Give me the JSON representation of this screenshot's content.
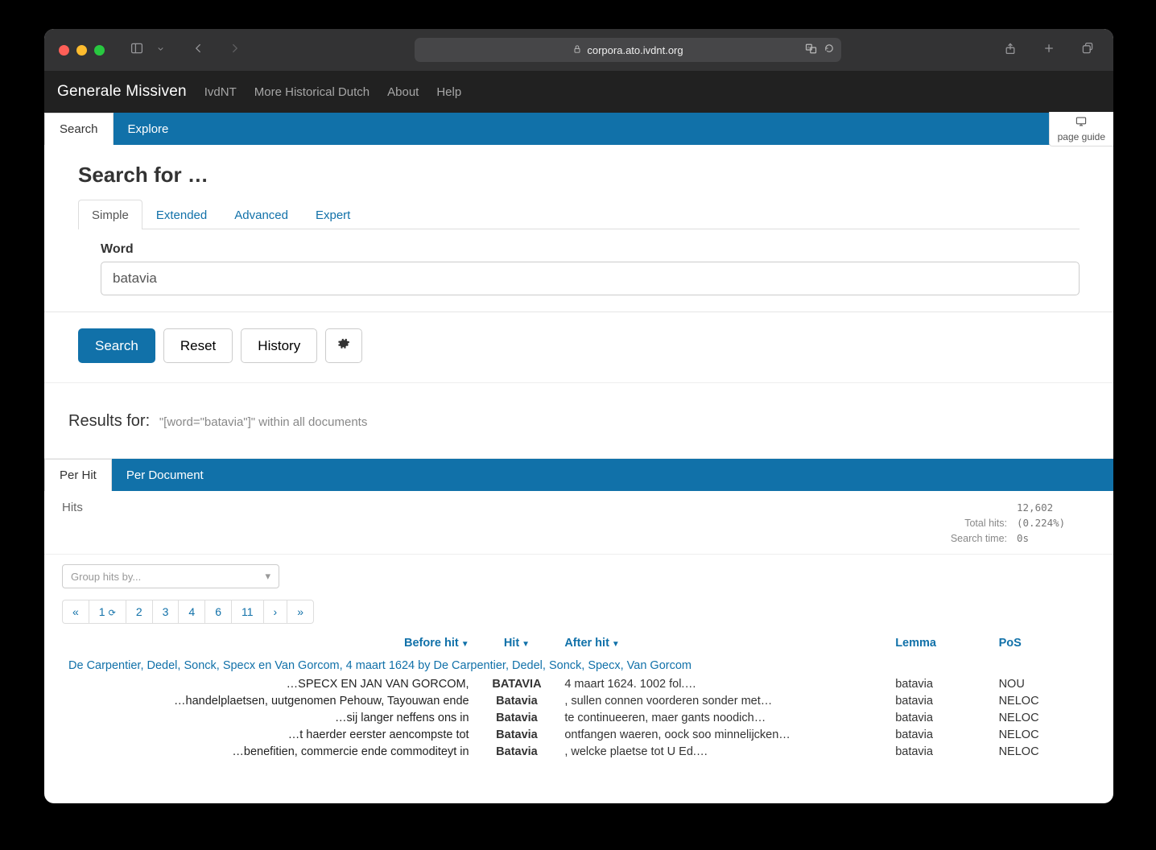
{
  "browser": {
    "url": "corpora.ato.ivdnt.org"
  },
  "appnav": {
    "brand": "Generale Missiven",
    "links": [
      "IvdNT",
      "More Historical Dutch",
      "About",
      "Help"
    ]
  },
  "contentTabs": {
    "search": "Search",
    "explore": "Explore"
  },
  "pageGuide": "page guide",
  "searchHeading": "Search for …",
  "subtabs": [
    "Simple",
    "Extended",
    "Advanced",
    "Expert"
  ],
  "field": {
    "label": "Word",
    "value": "batavia"
  },
  "buttons": {
    "search": "Search",
    "reset": "Reset",
    "history": "History"
  },
  "resultsFor": {
    "label": "Results for:",
    "query": "\"[word=\"batavia\"]\" within all documents"
  },
  "resultsTabs": {
    "perHit": "Per Hit",
    "perDoc": "Per Document"
  },
  "hitsLabel": "Hits",
  "stats": {
    "totalHitsLabel": "Total hits:",
    "totalHitsValue": "12,602 (0.224%)",
    "searchTimeLabel": "Search time:",
    "searchTimeValue": "0s"
  },
  "groupBy": "Group hits by...",
  "pagination": {
    "prev": "«",
    "pages": [
      "1",
      "2",
      "3",
      "4",
      "6",
      "11"
    ],
    "next1": "›",
    "next2": "»"
  },
  "columns": {
    "before": "Before hit",
    "hit": "Hit",
    "after": "After hit",
    "lemma": "Lemma",
    "pos": "PoS"
  },
  "docTitle": "De Carpentier, Dedel, Sonck, Specx en Van Gorcom, 4 maart 1624 by De Carpentier, Dedel, Sonck, Specx, Van Gorcom",
  "rows": [
    {
      "before": "…SPECX EN JAN VAN GORCOM,",
      "hit": "BATAVIA",
      "after": "4 maart 1624. 1002 fol.…",
      "lemma": "batavia",
      "pos": "NOU"
    },
    {
      "before": "…handelplaetsen, uutgenomen Pehouw, Tayouwan ende",
      "hit": "Batavia",
      "after": ", sullen connen voorderen sonder met…",
      "lemma": "batavia",
      "pos": "NELOC"
    },
    {
      "before": "…sij langer neffens ons in",
      "hit": "Batavia",
      "after": "te continueeren, maer gants noodich…",
      "lemma": "batavia",
      "pos": "NELOC"
    },
    {
      "before": "…t haerder eerster aencompste tot",
      "hit": "Batavia",
      "after": "ontfangen waeren, oock soo minnelijcken…",
      "lemma": "batavia",
      "pos": "NELOC"
    },
    {
      "before": "…benefitien, commercie ende commoditeyt in",
      "hit": "Batavia",
      "after": ", welcke plaetse tot U Ed.…",
      "lemma": "batavia",
      "pos": "NELOC"
    }
  ]
}
